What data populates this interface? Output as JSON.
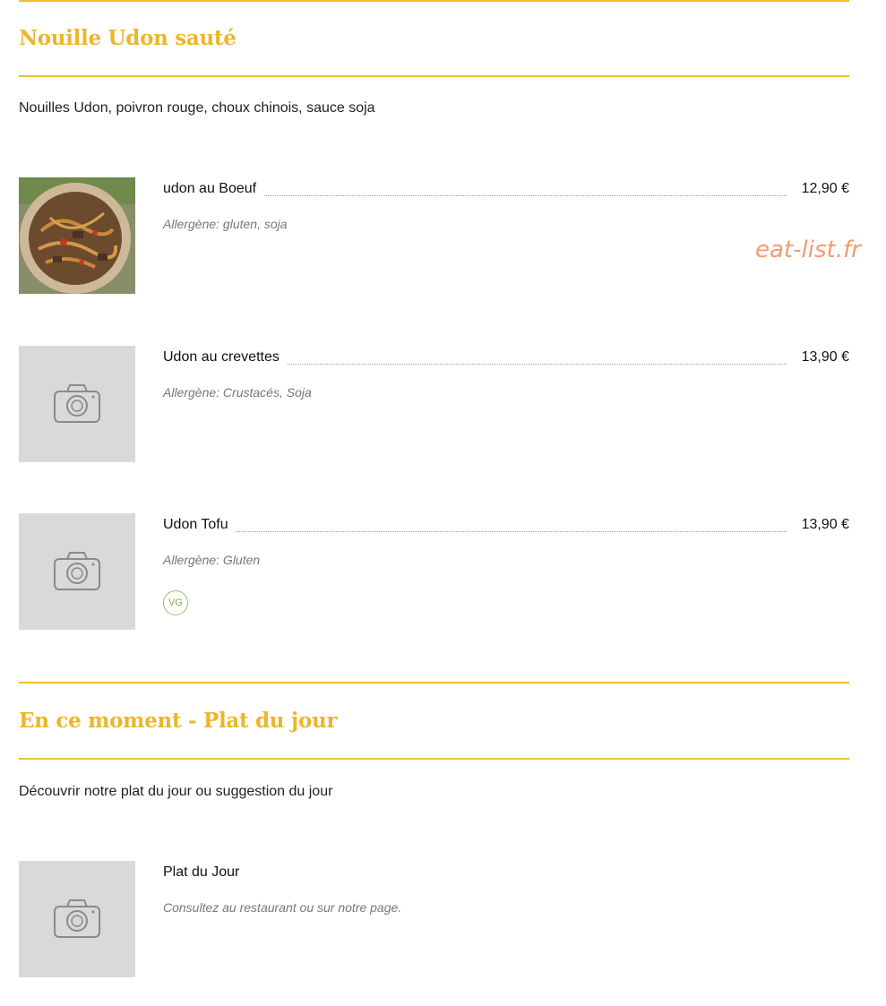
{
  "sections": [
    {
      "title": "Nouille Udon sauté",
      "description": "Nouilles Udon, poivron rouge, choux chinois, sauce soja",
      "items": [
        {
          "name": "udon au Boeuf",
          "price": "12,90 €",
          "allergens": "Allergène: gluten, soja",
          "image": "udon-beef-photo"
        },
        {
          "name": "Udon au crevettes",
          "price": "13,90 €",
          "allergens": "Allergène: Crustacés, Soja",
          "image": "camera-placeholder"
        },
        {
          "name": "Udon Tofu",
          "price": "13,90 €",
          "allergens": "Allergène: Gluten",
          "badge": "VG",
          "image": "camera-placeholder"
        }
      ]
    },
    {
      "title": "En ce moment - Plat du jour",
      "description": "Découvrir notre plat du jour ou suggestion du jour",
      "items": [
        {
          "name": "Plat du Jour",
          "allergens": "Consultez au restaurant ou sur notre page.",
          "image": "camera-placeholder"
        }
      ]
    }
  ],
  "watermark": "eat-list.fr",
  "colors": {
    "accent": "#ecc22a",
    "title": "#ecb62a",
    "vg": "#8ab858",
    "watermark": "#f39a72",
    "placeholder": "#d9d9d9"
  }
}
